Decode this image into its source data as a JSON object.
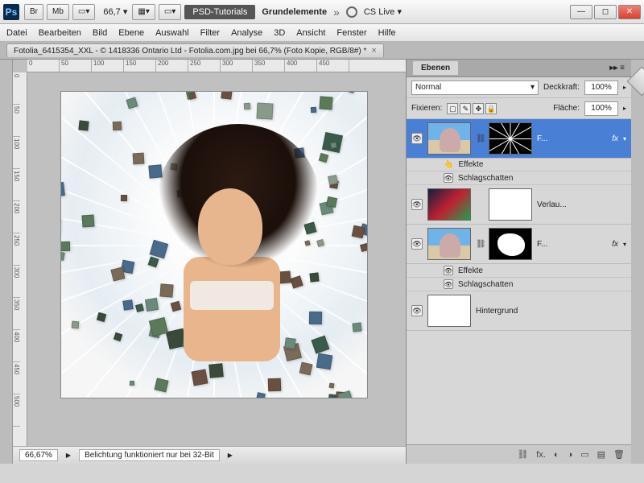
{
  "titlebar": {
    "ps": "Ps",
    "br": "Br",
    "mb": "Mb",
    "zoom": "66,7",
    "tag": "PSD-Tutorials",
    "subtitle": "Grundelemente",
    "cslive": "CS Live"
  },
  "menu": {
    "items": [
      "Datei",
      "Bearbeiten",
      "Bild",
      "Ebene",
      "Auswahl",
      "Filter",
      "Analyse",
      "3D",
      "Ansicht",
      "Fenster",
      "Hilfe"
    ]
  },
  "doctab": {
    "title": "Fotolia_6415354_XXL - © 1418336 Ontario Ltd - Fotolia.com.jpg bei 66,7% (Foto Kopie, RGB/8#) *"
  },
  "ruler": {
    "h": [
      "0",
      "50",
      "100",
      "150",
      "200",
      "250",
      "300",
      "350",
      "400",
      "450"
    ],
    "v": [
      "0",
      "50",
      "100",
      "150",
      "200",
      "250",
      "300",
      "350",
      "400",
      "450",
      "500"
    ]
  },
  "layers_panel": {
    "tab": "Ebenen",
    "blend_mode": "Normal",
    "opacity_label": "Deckkraft:",
    "opacity_value": "100%",
    "lock_label": "Fixieren:",
    "fill_label": "Fläche:",
    "fill_value": "100%",
    "layers": [
      {
        "name": "F...",
        "fx": "fx",
        "effects_label": "Effekte",
        "sub_effect": "Schlagschatten"
      },
      {
        "name": "Verlau..."
      },
      {
        "name": "F...",
        "fx": "fx",
        "effects_label": "Effekte",
        "sub_effect": "Schlagschatten"
      },
      {
        "name": "Hintergrund"
      }
    ]
  },
  "status": {
    "zoom": "66,67%",
    "msg": "Belichtung funktioniert nur bei 32-Bit"
  }
}
